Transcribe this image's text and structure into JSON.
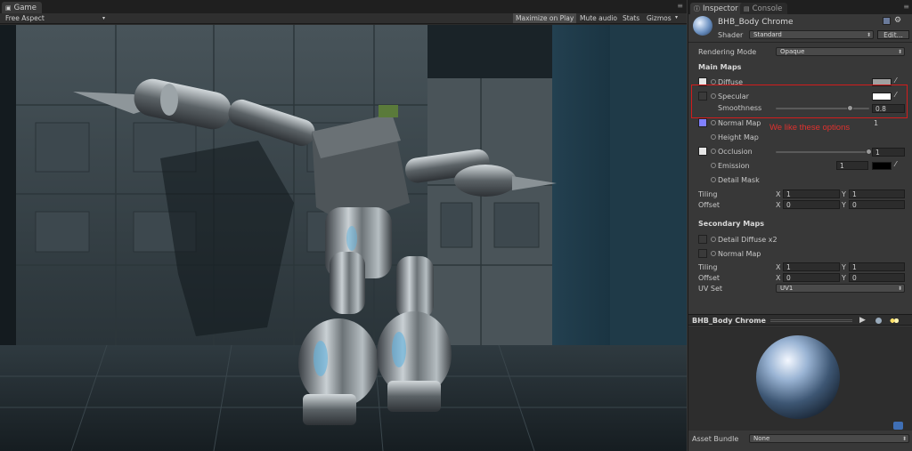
{
  "game_panel": {
    "tab_label": "Game",
    "aspect": "Free Aspect",
    "toolbar": {
      "maximize": "Maximize on Play",
      "mute": "Mute audio",
      "stats": "Stats",
      "gizmos": "Gizmos"
    }
  },
  "inspector": {
    "tab_inspector": "Inspector",
    "tab_console": "Console",
    "material_name": "BHB_Body Chrome",
    "shader_label": "Shader",
    "shader_value": "Standard",
    "edit_button": "Edit...",
    "rendering_mode_label": "Rendering Mode",
    "rendering_mode_value": "Opaque",
    "main_maps_header": "Main Maps",
    "diffuse_label": "Diffuse",
    "specular_label": "Specular",
    "smoothness_label": "Smoothness",
    "smoothness_value": "0.8",
    "smoothness_fraction": 0.8,
    "normal_map_label": "Normal Map",
    "normal_map_value": "1",
    "height_map_label": "Height Map",
    "occlusion_label": "Occlusion",
    "occlusion_value": "1",
    "occlusion_fraction": 1.0,
    "emission_label": "Emission",
    "emission_value": "1",
    "detail_mask_label": "Detail Mask",
    "tiling_label": "Tiling",
    "offset_label": "Offset",
    "x_label": "X",
    "y_label": "Y",
    "tiling_x": "1",
    "tiling_y": "1",
    "offset_x": "0",
    "offset_y": "0",
    "secondary_maps_header": "Secondary Maps",
    "detail_diffuse_label": "Detail Diffuse x2",
    "normal_map2_label": "Normal Map",
    "tiling2_x": "1",
    "tiling2_y": "1",
    "offset2_x": "0",
    "offset2_y": "0",
    "uv_set_label": "UV Set",
    "uv_set_value": "UV1",
    "preview_title": "BHB_Body Chrome",
    "asset_bundle_label": "Asset Bundle",
    "asset_bundle_value": "None"
  },
  "annotation": {
    "text": "We like these options",
    "color": "#e0312e"
  },
  "colors": {
    "highlight": "#d21c1c",
    "panel_bg": "#383838"
  }
}
